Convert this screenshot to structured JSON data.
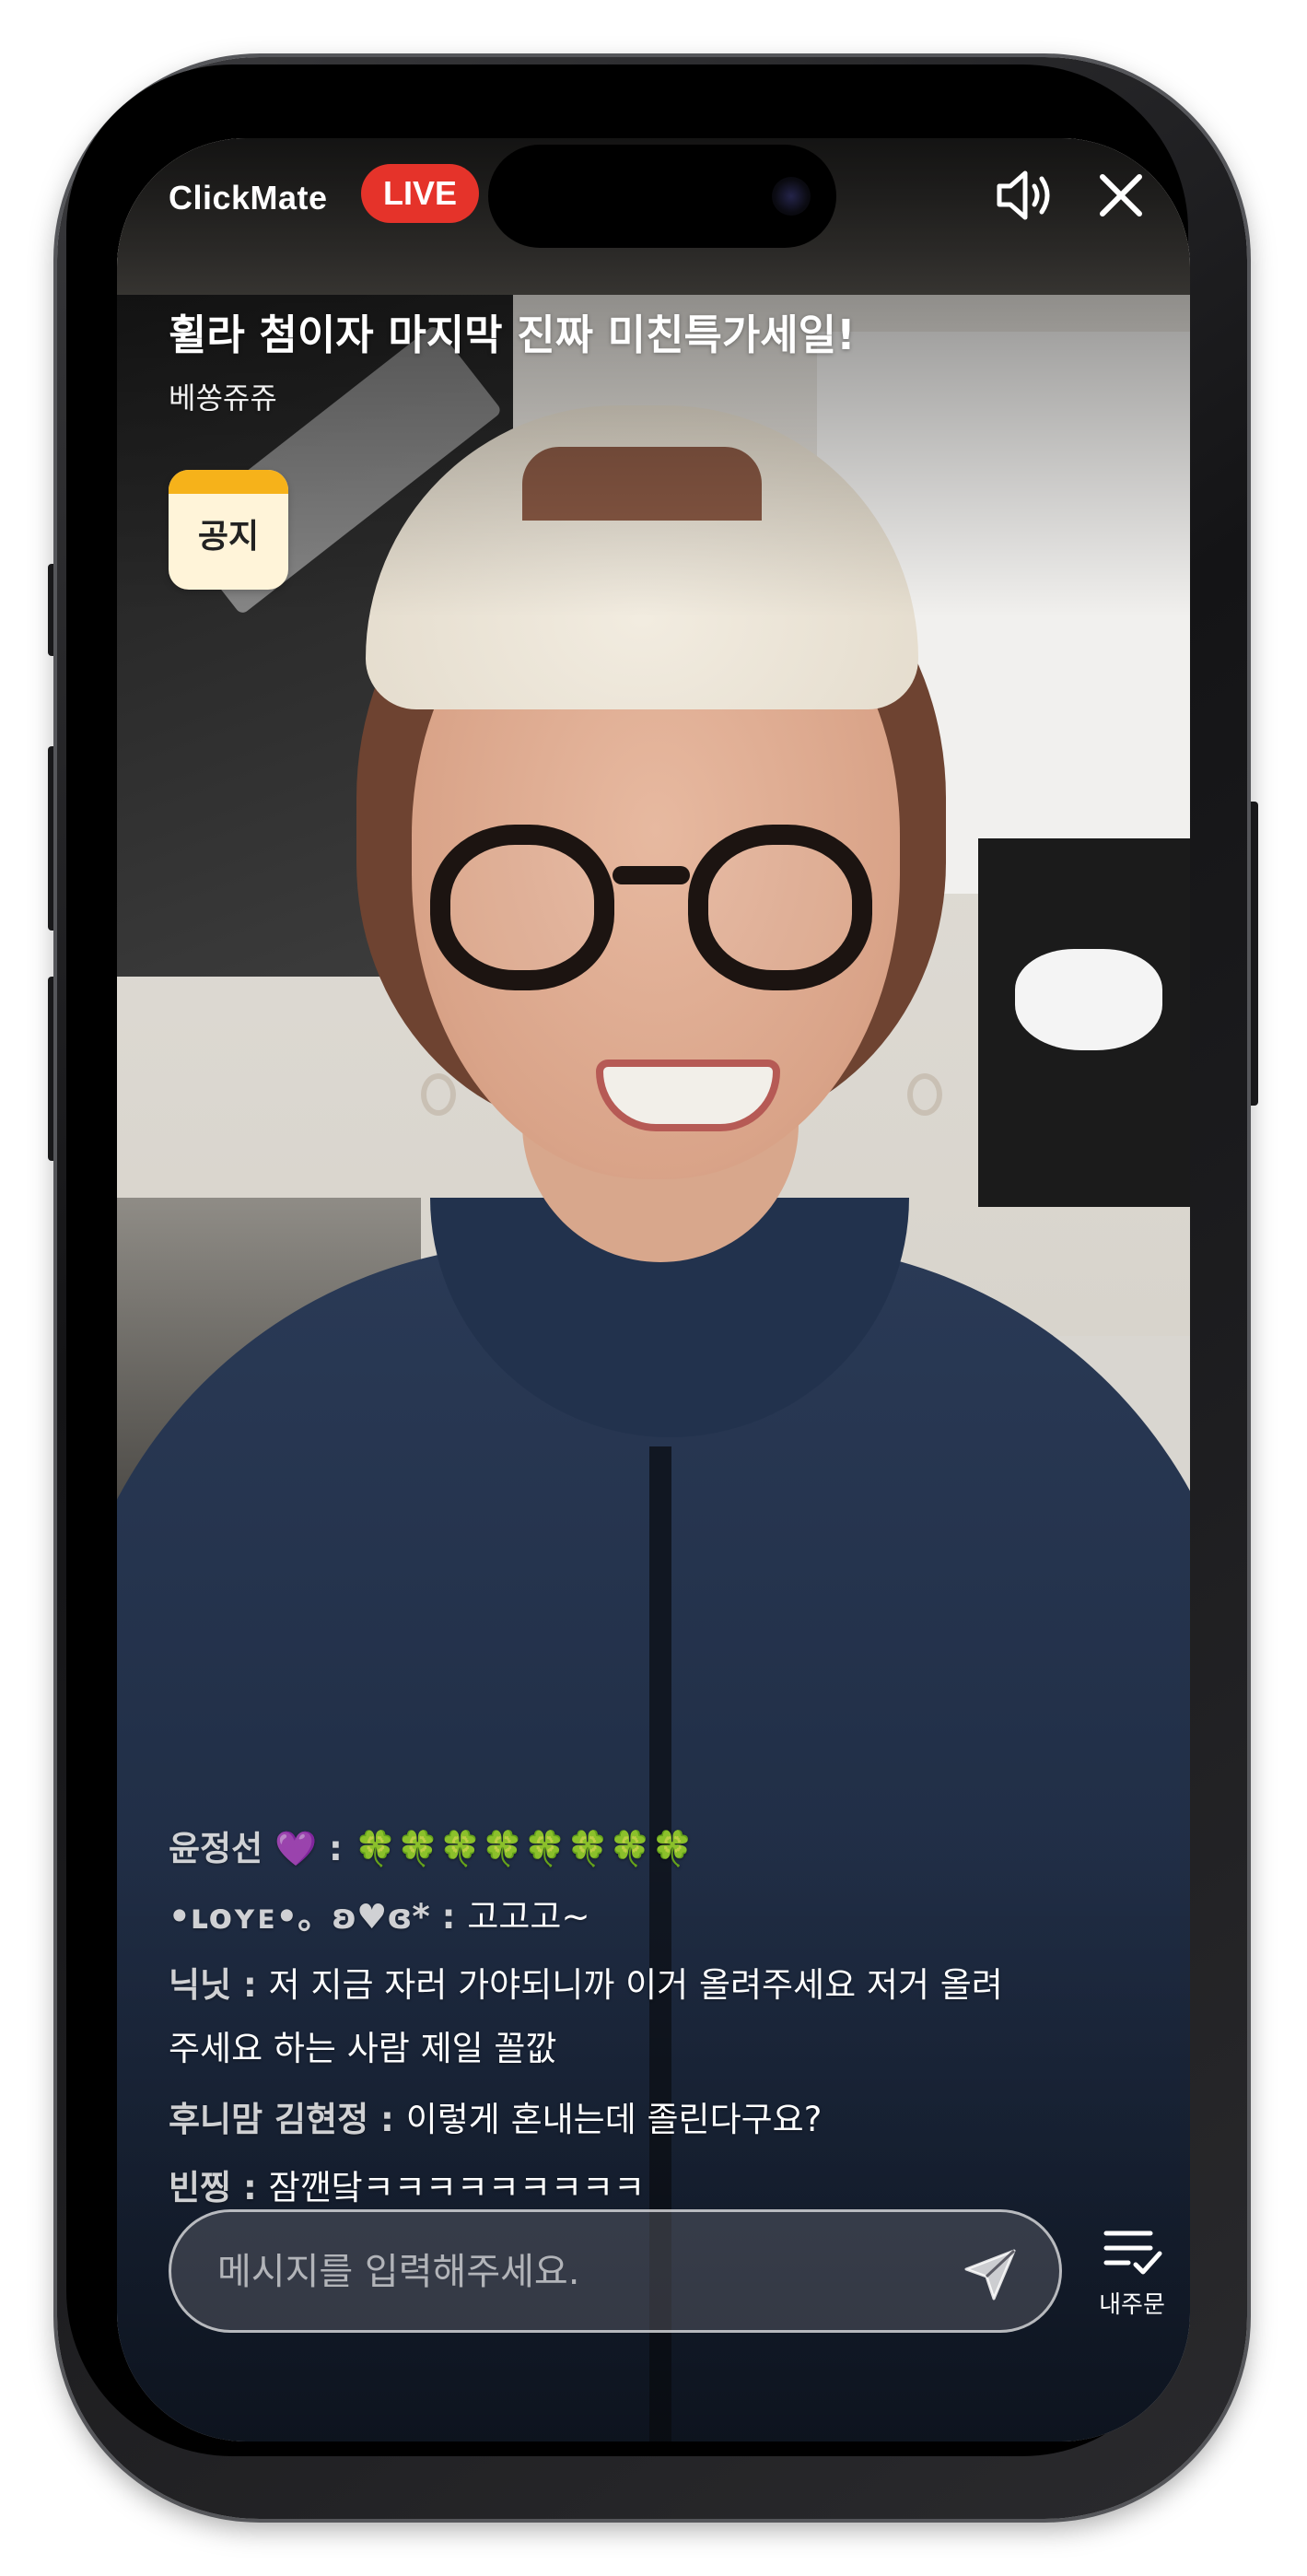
{
  "header": {
    "brand": "ClickMate",
    "live_badge": "LIVE",
    "sound_icon": "speaker-icon",
    "close_icon": "close-icon"
  },
  "broadcast": {
    "title": "휠라 첨이자 마지막 진짜 미친특가세일!",
    "host": "베쏭쥬쥬"
  },
  "notice": {
    "label": "공지"
  },
  "chat": {
    "messages": [
      {
        "name": "윤정선 💜",
        "text": "🍀🍀🍀🍀🍀🍀🍀🍀"
      },
      {
        "name": "•ʟᴏʏᴇ•。ʚ♥ɞ*",
        "text": "고고고~"
      },
      {
        "name": "닉닛",
        "text": "저 지금 자러 가야되니까 이거 올려주세요 저거 올려"
      },
      {
        "name": "",
        "text": "주세요 하는 사람 제일 꼴깞"
      },
      {
        "name": "후니맘 김현정",
        "text": "이렇게 혼내는데 졸린다구요?"
      },
      {
        "name": "빈찡",
        "text": "잠깬닼ㅋㅋㅋㅋㅋㅋㅋㅋㅋ"
      }
    ]
  },
  "input": {
    "placeholder": "메시지를 입력해주세요.",
    "value": "",
    "send_icon": "send-icon"
  },
  "orders": {
    "label": "내주문",
    "icon": "order-list-icon"
  },
  "colors": {
    "live_red": "#e5332a",
    "notice_yellow": "#f6b21a",
    "notice_bg": "#fff4d9"
  }
}
